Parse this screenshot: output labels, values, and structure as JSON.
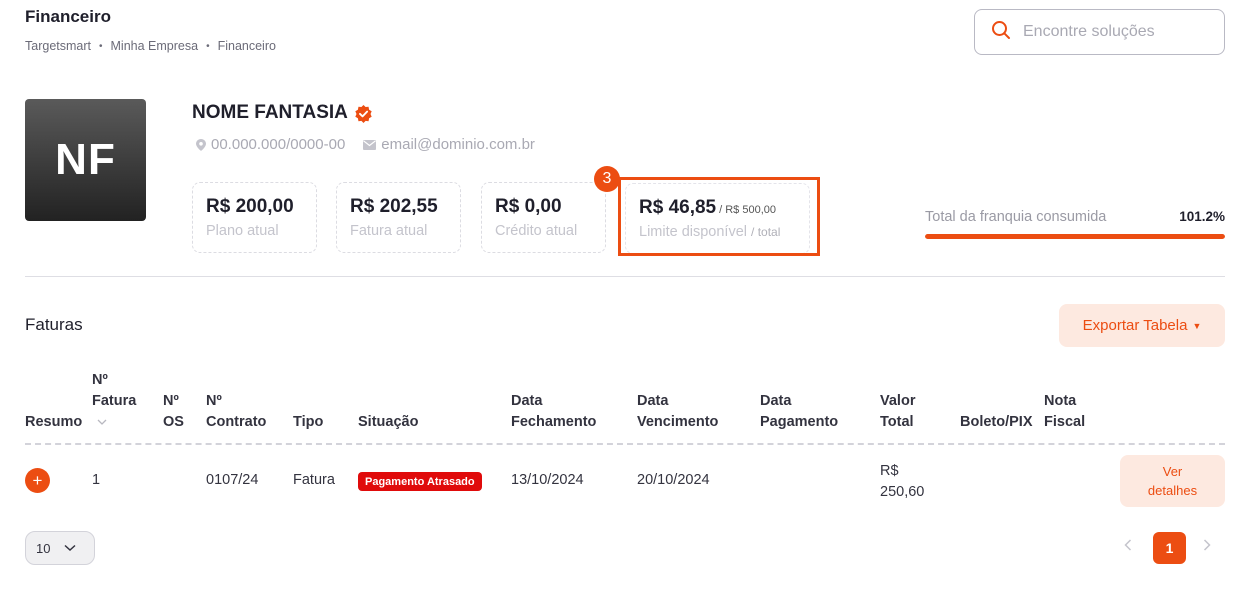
{
  "header": {
    "title": "Financeiro",
    "breadcrumb": [
      "Targetsmart",
      "Minha Empresa",
      "Financeiro"
    ],
    "breadcrumb_sep": "•"
  },
  "search": {
    "placeholder": "Encontre soluções"
  },
  "company": {
    "initials": "NF",
    "name": "NOME FANTASIA",
    "cnpj": "00.000.000/0000-00",
    "email": "email@dominio.com.br"
  },
  "cards": {
    "plano": {
      "value": "R$ 200,00",
      "label": "Plano atual"
    },
    "fatura": {
      "value": "R$ 202,55",
      "label": "Fatura atual"
    },
    "credito": {
      "value": "R$ 0,00",
      "label": "Crédito atual"
    },
    "limite": {
      "value": "R$ 46,85",
      "total": "/ R$ 500,00",
      "label": "Limite disponível",
      "label_total": "/ total"
    }
  },
  "highlight": {
    "step": "3"
  },
  "franquia": {
    "label": "Total da franquia consumida",
    "percent": "101.2%",
    "fill_fraction": 1.0
  },
  "faturas": {
    "title": "Faturas",
    "export_label": "Exportar Tabela",
    "columns": {
      "resumo": "Resumo",
      "nfatura_1": "Nº",
      "nfatura_2": "Fatura",
      "os_1": "Nº",
      "os_2": "OS",
      "contrato_1": "Nº",
      "contrato_2": "Contrato",
      "tipo": "Tipo",
      "situacao": "Situação",
      "fechamento_1": "Data",
      "fechamento_2": "Fechamento",
      "vencimento_1": "Data",
      "vencimento_2": "Vencimento",
      "pagamento_1": "Data",
      "pagamento_2": "Pagamento",
      "valor_1": "Valor",
      "valor_2": "Total",
      "boleto": "Boleto/PIX",
      "nota_1": "Nota",
      "nota_2": "Fiscal"
    },
    "rows": [
      {
        "fatura": "1",
        "os": "",
        "contrato": "0107/24",
        "tipo": "Fatura",
        "situacao": "Pagamento Atrasado",
        "fechamento": "13/10/2024",
        "vencimento": "20/10/2024",
        "pagamento": "",
        "valor_1": "R$",
        "valor_2": "250,60",
        "action_1": "Ver",
        "action_2": "detalhes"
      }
    ]
  },
  "pagination": {
    "page_size": "10",
    "current": "1"
  },
  "colors": {
    "accent": "#ec4d12",
    "danger": "#e00b0b",
    "accent_soft": "#fde9e0"
  }
}
